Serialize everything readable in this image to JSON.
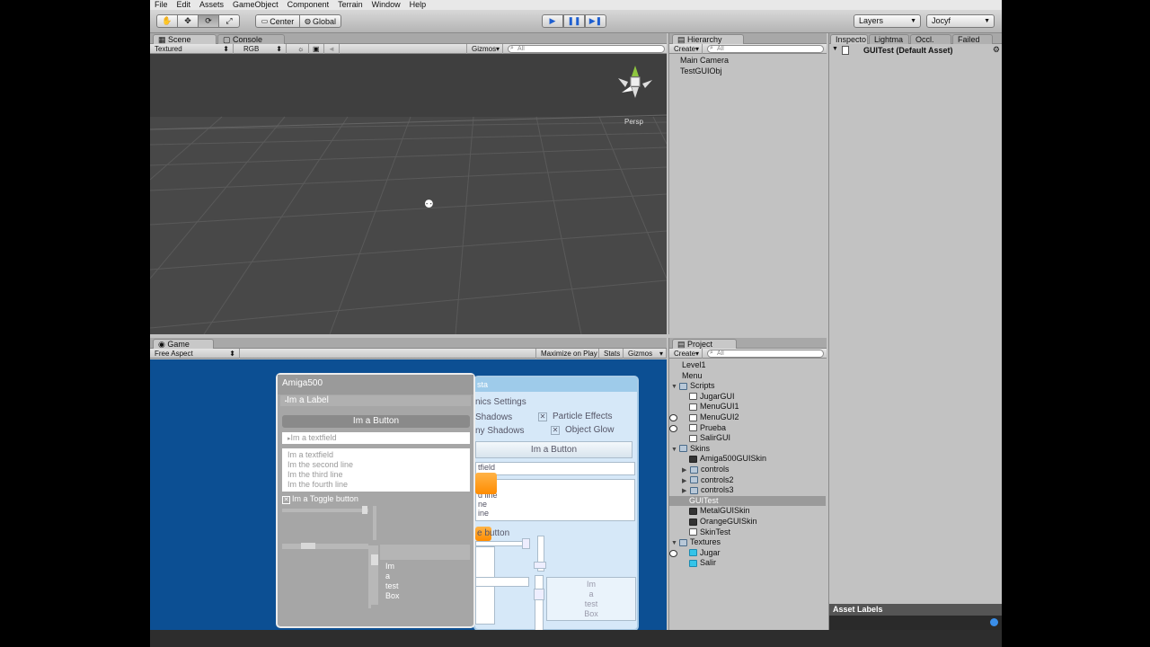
{
  "menu": [
    "File",
    "Edit",
    "Assets",
    "GameObject",
    "Component",
    "Terrain",
    "Window",
    "Help"
  ],
  "toolbar": {
    "pivot": "Center",
    "space": "Global",
    "layers": "Layers",
    "layout": "Jocyf"
  },
  "scene_panel": {
    "tab_scene": "Scene",
    "tab_console": "Console",
    "render_mode": "Textured",
    "color_mode": "RGB",
    "gizmos": "Gizmos",
    "search_placeholder": "All",
    "persp": "Persp"
  },
  "hierarchy": {
    "tab": "Hierarchy",
    "create": "Create",
    "search_placeholder": "All",
    "items": [
      "Main Camera",
      "TestGUIObj"
    ]
  },
  "inspector": {
    "tabs": [
      "Inspecto",
      "Lightma",
      "Occl. Cu",
      "Failed"
    ],
    "asset": "GUITest (Default Asset)",
    "asset_labels": "Asset Labels"
  },
  "game_panel": {
    "tab": "Game",
    "aspect": "Free Aspect",
    "maximize": "Maximize on Play",
    "stats": "Stats",
    "gizmos": "Gizmos"
  },
  "project": {
    "tab": "Project",
    "create": "Create",
    "search_placeholder": "All",
    "items": [
      {
        "label": "Level1",
        "indent": 1,
        "icon": "scene"
      },
      {
        "label": "Menu",
        "indent": 1,
        "icon": "scene"
      },
      {
        "label": "Scripts",
        "indent": 0,
        "icon": "folder",
        "expanded": true
      },
      {
        "label": "JugarGUI",
        "indent": 2,
        "icon": "script"
      },
      {
        "label": "MenuGUI1",
        "indent": 2,
        "icon": "script"
      },
      {
        "label": "MenuGUI2",
        "indent": 2,
        "icon": "script"
      },
      {
        "label": "Prueba",
        "indent": 2,
        "icon": "script"
      },
      {
        "label": "SalirGUI",
        "indent": 2,
        "icon": "script"
      },
      {
        "label": "Skins",
        "indent": 0,
        "icon": "folder",
        "expanded": true
      },
      {
        "label": "Amiga500GUISkin",
        "indent": 2,
        "icon": "skin"
      },
      {
        "label": "controls",
        "indent": 1,
        "icon": "folder",
        "collapsed": true
      },
      {
        "label": "controls2",
        "indent": 1,
        "icon": "folder",
        "collapsed": true
      },
      {
        "label": "controls3",
        "indent": 1,
        "icon": "folder",
        "collapsed": true
      },
      {
        "label": "GUITest",
        "indent": 2,
        "icon": "scene",
        "selected": true
      },
      {
        "label": "MetalGUISkin",
        "indent": 2,
        "icon": "skin"
      },
      {
        "label": "OrangeGUISkin",
        "indent": 2,
        "icon": "skin"
      },
      {
        "label": "SkinTest",
        "indent": 2,
        "icon": "script"
      },
      {
        "label": "Textures",
        "indent": 0,
        "icon": "folder",
        "expanded": true
      },
      {
        "label": "Jugar",
        "indent": 2,
        "icon": "tex"
      },
      {
        "label": "Salir",
        "indent": 2,
        "icon": "tex"
      }
    ]
  },
  "amiga_window": {
    "title": "Amiga500",
    "label": "Im a Label",
    "button": "Im a Button",
    "textfield": "Im a textfield",
    "textarea": [
      "Im a textfield",
      "Im the second line",
      "Im the third line",
      "Im the fourth line"
    ],
    "toggle": "Im a Toggle button",
    "box": [
      "Im",
      "a",
      "test",
      "Box"
    ]
  },
  "orange_window": {
    "title": "sta",
    "graphics": "nics Settings",
    "shadows": "Shadows",
    "shadows2": "ny Shadows",
    "particle": "Particle Effects",
    "glow": "Object Glow",
    "button": "Im a Button",
    "textfield": "tfield",
    "lines": [
      "d line",
      "ne",
      "ine"
    ],
    "toggle": "e button",
    "box": [
      "Im",
      "a",
      "test",
      "Box"
    ]
  }
}
